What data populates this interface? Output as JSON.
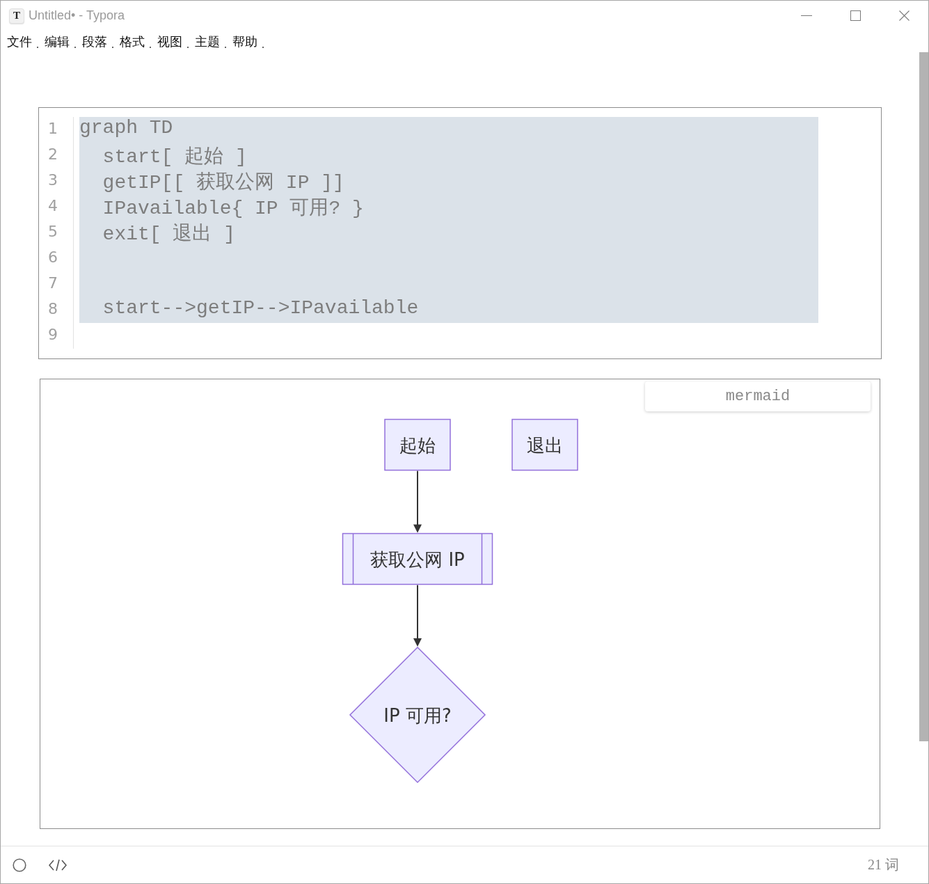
{
  "window": {
    "icon": "T",
    "title": "Untitled• - Typora"
  },
  "menu": [
    {
      "label": "文件"
    },
    {
      "label": "编辑"
    },
    {
      "label": "段落"
    },
    {
      "label": "格式"
    },
    {
      "label": "视图"
    },
    {
      "label": "主题"
    },
    {
      "label": "帮助"
    }
  ],
  "code_block": {
    "lines": [
      {
        "number": "1",
        "text": "graph TD",
        "selected": true
      },
      {
        "number": "2",
        "text": "  start[ 起始 ]",
        "selected": true
      },
      {
        "number": "3",
        "text": "  getIP[[ 获取公网 IP ]]",
        "selected": true
      },
      {
        "number": "4",
        "text": "  IPavailable{ IP 可用? }",
        "selected": true
      },
      {
        "number": "5",
        "text": "  exit[ 退出 ]",
        "selected": true
      },
      {
        "number": "6",
        "selected": true
      },
      {
        "number": "7",
        "selected": true
      },
      {
        "number": "8",
        "text": "  start-->getIP-->IPavailable",
        "selected": true
      },
      {
        "number": "9",
        "selected": false
      }
    ]
  },
  "diagram": {
    "language": "mermaid",
    "nodes": [
      {
        "kind": "rect",
        "label": "起始",
        "arrow_out": true
      },
      {
        "kind": "rect",
        "label": "退出",
        "arrow_out": false
      },
      {
        "kind": "subroutine",
        "label": "获取公网 IP",
        "arrow_out": true
      },
      {
        "kind": "diamond",
        "label": "IP 可用?",
        "arrow_out": false
      }
    ]
  },
  "status_bar": {
    "word_count": "21 词"
  }
}
